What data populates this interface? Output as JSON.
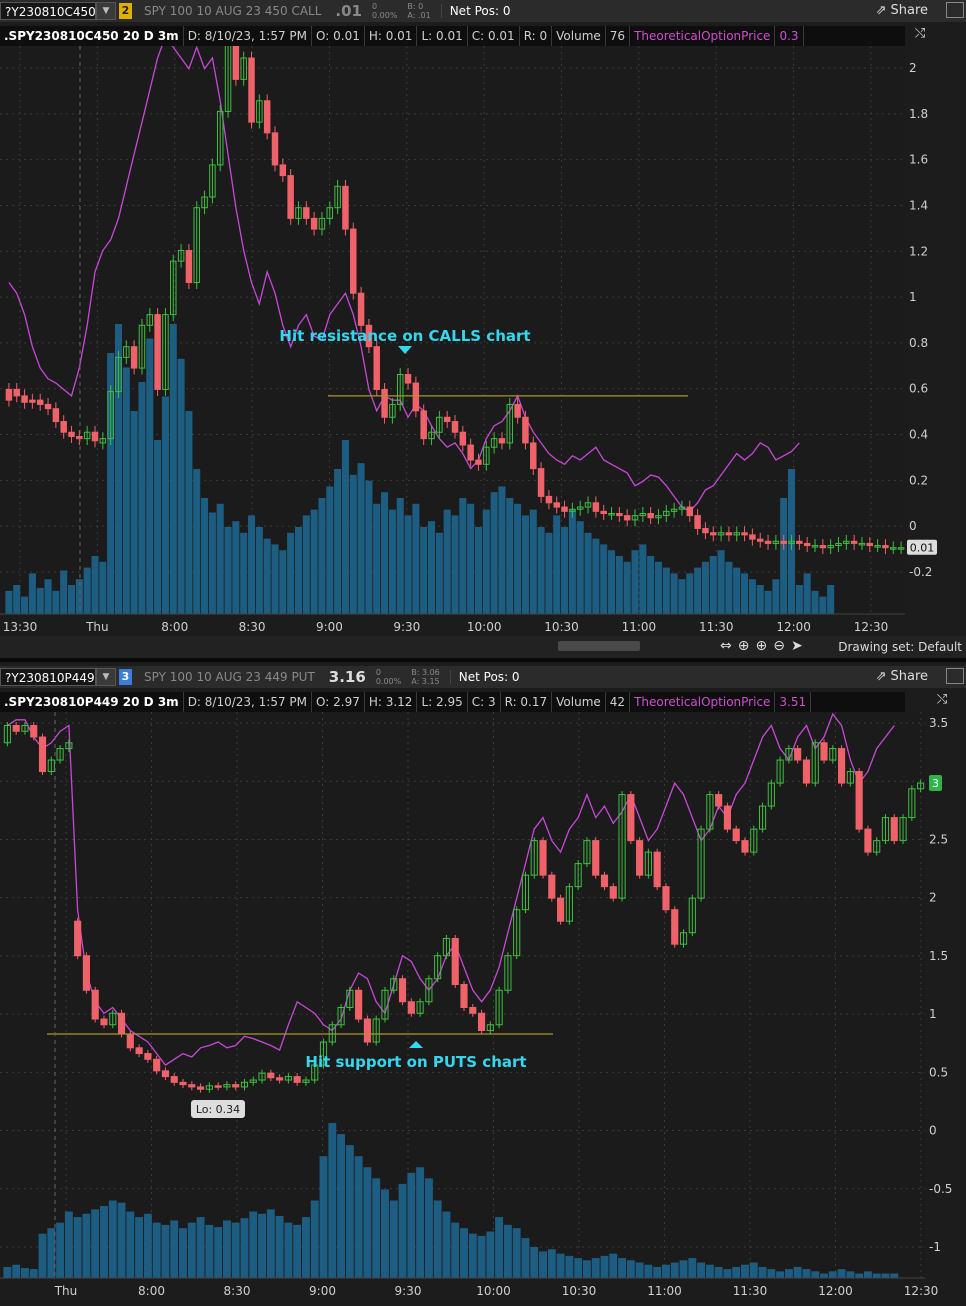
{
  "top": {
    "symbol": "?Y230810C450",
    "link_num": "2",
    "link_color": "#e0b000",
    "description": "SPY 100 10 AUG 23 450 CALL",
    "last": ".01",
    "change": "0",
    "change_pct": "0.00%",
    "bid": "B: 0",
    "ask": "A: .01",
    "net_pos": "Net Pos: 0",
    "share_label": "Share",
    "info": {
      "title": ".SPY230810C450 20 D 3m",
      "date": "D: 8/10/23, 1:57 PM",
      "open": "O: 0.01",
      "high": "H: 0.01",
      "low": "L: 0.01",
      "close": "C: 0.01",
      "range": "R: 0",
      "volume_label": "Volume",
      "volume_value": "76",
      "study_label": "TheoreticalOptionPrice",
      "study_value": "0.3"
    },
    "annotation": "Hit resistance on CALLS chart",
    "price_tag": "0.01",
    "drawing_set": "Drawing set: Default"
  },
  "bottom": {
    "symbol": "?Y230810P449",
    "link_num": "3",
    "link_color": "#3b7dd8",
    "description": "SPY 100 10 AUG 23 449 PUT",
    "last": "3.16",
    "change": "0",
    "change_pct": "0.00%",
    "bid": "B: 3.06",
    "ask": "A: 3.15",
    "net_pos": "Net Pos: 0",
    "share_label": "Share",
    "info": {
      "title": ".SPY230810P449 20 D 3m",
      "date": "D: 8/10/23, 1:57 PM",
      "open": "O: 2.97",
      "high": "H: 3.12",
      "low": "L: 2.95",
      "close": "C: 3",
      "range": "R: 0.17",
      "volume_label": "Volume",
      "volume_value": "42",
      "study_label": "TheoreticalOptionPrice",
      "study_value": "3.51"
    },
    "annotation": "Hit support on PUTS chart",
    "low_label": "Lo: 0.34",
    "price_tag": "3"
  },
  "colors": {
    "up": "#3fbf3f",
    "down": "#f0626a",
    "volume": "#1e5d82",
    "study": "#c848d8",
    "level": "#a8962a",
    "annotation": "#36d6ee",
    "grid": "#3a3a3a",
    "axis_text": "#cfcfcf"
  },
  "chart_data": [
    {
      "type": "candlestick",
      "title": ".SPY230810C450 20 D 3m",
      "x_ticks": [
        "13:30",
        "Thu",
        "8:00",
        "8:30",
        "9:00",
        "9:30",
        "10:00",
        "10:30",
        "11:00",
        "11:30",
        "12:00",
        "12:30"
      ],
      "y_ticks": [
        "-0.2",
        "0",
        "0.2",
        "0.4",
        "0.6",
        "0.8",
        "1",
        "1.2",
        "1.4",
        "1.6",
        "1.8",
        "2"
      ],
      "ylim": [
        -0.3,
        2.3
      ],
      "candles": [
        [
          0.75,
          0.7
        ],
        [
          0.75,
          0.72
        ],
        [
          0.72,
          0.69
        ],
        [
          0.7,
          0.69
        ],
        [
          0.7,
          0.68
        ],
        [
          0.68,
          0.66
        ],
        [
          0.66,
          0.6
        ],
        [
          0.6,
          0.55
        ],
        [
          0.55,
          0.53
        ],
        [
          0.53,
          0.52
        ],
        [
          0.52,
          0.55
        ],
        [
          0.55,
          0.51
        ],
        [
          0.5,
          0.52
        ],
        [
          0.52,
          0.74
        ],
        [
          0.74,
          0.9
        ],
        [
          0.9,
          0.95
        ],
        [
          0.95,
          0.85
        ],
        [
          0.85,
          1.05
        ],
        [
          1.05,
          1.1
        ],
        [
          1.1,
          0.75
        ],
        [
          0.75,
          1.1
        ],
        [
          1.1,
          1.35
        ],
        [
          1.35,
          1.4
        ],
        [
          1.4,
          1.25
        ],
        [
          1.25,
          1.6
        ],
        [
          1.6,
          1.65
        ],
        [
          1.65,
          1.8
        ],
        [
          1.8,
          2.05
        ],
        [
          2.05,
          2.4
        ],
        [
          2.4,
          2.2
        ],
        [
          2.2,
          2.3
        ],
        [
          2.3,
          2.0
        ],
        [
          2.0,
          2.1
        ],
        [
          2.1,
          1.95
        ],
        [
          1.95,
          1.8
        ],
        [
          1.8,
          1.75
        ],
        [
          1.75,
          1.55
        ],
        [
          1.55,
          1.6
        ],
        [
          1.6,
          1.55
        ],
        [
          1.55,
          1.5
        ],
        [
          1.5,
          1.55
        ],
        [
          1.55,
          1.6
        ],
        [
          1.6,
          1.7
        ],
        [
          1.7,
          1.5
        ],
        [
          1.5,
          1.2
        ],
        [
          1.2,
          1.05
        ],
        [
          1.05,
          0.95
        ],
        [
          0.95,
          0.75
        ],
        [
          0.75,
          0.62
        ],
        [
          0.62,
          0.68
        ],
        [
          0.68,
          0.82
        ],
        [
          0.82,
          0.78
        ],
        [
          0.78,
          0.65
        ],
        [
          0.65,
          0.52
        ],
        [
          0.52,
          0.55
        ],
        [
          0.55,
          0.62
        ],
        [
          0.62,
          0.6
        ],
        [
          0.6,
          0.55
        ],
        [
          0.55,
          0.49
        ],
        [
          0.49,
          0.42
        ],
        [
          0.42,
          0.4
        ],
        [
          0.4,
          0.48
        ],
        [
          0.48,
          0.52
        ],
        [
          0.52,
          0.5
        ],
        [
          0.5,
          0.68
        ],
        [
          0.68,
          0.62
        ],
        [
          0.62,
          0.5
        ],
        [
          0.5,
          0.38
        ],
        [
          0.38,
          0.25
        ],
        [
          0.25,
          0.22
        ],
        [
          0.22,
          0.2
        ],
        [
          0.2,
          0.18
        ],
        [
          0.18,
          0.19
        ],
        [
          0.19,
          0.2
        ],
        [
          0.2,
          0.22
        ],
        [
          0.22,
          0.18
        ],
        [
          0.18,
          0.17
        ],
        [
          0.17,
          0.17
        ],
        [
          0.17,
          0.16
        ],
        [
          0.16,
          0.14
        ],
        [
          0.14,
          0.16
        ],
        [
          0.16,
          0.17
        ],
        [
          0.17,
          0.15
        ],
        [
          0.15,
          0.16
        ],
        [
          0.16,
          0.18
        ],
        [
          0.18,
          0.19
        ],
        [
          0.19,
          0.2
        ],
        [
          0.2,
          0.16
        ],
        [
          0.16,
          0.1
        ],
        [
          0.1,
          0.08
        ],
        [
          0.08,
          0.07
        ],
        [
          0.07,
          0.08
        ],
        [
          0.08,
          0.07
        ],
        [
          0.07,
          0.08
        ],
        [
          0.08,
          0.07
        ],
        [
          0.07,
          0.05
        ],
        [
          0.05,
          0.04
        ],
        [
          0.04,
          0.03
        ],
        [
          0.03,
          0.04
        ],
        [
          0.04,
          0.03
        ],
        [
          0.03,
          0.04
        ],
        [
          0.04,
          0.03
        ],
        [
          0.03,
          0.02
        ],
        [
          0.02,
          0.02
        ],
        [
          0.02,
          0.01
        ],
        [
          0.01,
          0.02
        ],
        [
          0.02,
          0.03
        ],
        [
          0.03,
          0.04
        ],
        [
          0.04,
          0.03
        ],
        [
          0.03,
          0.03
        ],
        [
          0.03,
          0.02
        ],
        [
          0.02,
          0.02
        ],
        [
          0.02,
          0.01
        ],
        [
          0.01,
          0.01
        ],
        [
          0.01,
          0.01
        ]
      ],
      "study": [
        1.25,
        1.2,
        1.1,
        0.95,
        0.85,
        0.8,
        0.78,
        0.75,
        0.72,
        0.85,
        1.05,
        1.3,
        1.4,
        1.45,
        1.55,
        1.7,
        1.85,
        2.0,
        2.15,
        2.3,
        2.4,
        2.35,
        2.3,
        2.25,
        2.35,
        2.25,
        2.3,
        2.1,
        1.85,
        1.6,
        1.4,
        1.25,
        1.15,
        1.3,
        1.2,
        1.05,
        0.95,
        1.05,
        1.1,
        1.0,
        0.98,
        1.1,
        1.15,
        1.2,
        1.1,
        0.95,
        0.75,
        0.65,
        0.72,
        0.7,
        0.7,
        0.62,
        0.68,
        0.65,
        0.58,
        0.52,
        0.48,
        0.5,
        0.45,
        0.38,
        0.42,
        0.52,
        0.58,
        0.6,
        0.65,
        0.72,
        0.62,
        0.55,
        0.5,
        0.45,
        0.42,
        0.4,
        0.44,
        0.42,
        0.45,
        0.48,
        0.42,
        0.4,
        0.38,
        0.36,
        0.3,
        0.32,
        0.35,
        0.34,
        0.3,
        0.25,
        0.2,
        0.18,
        0.22,
        0.28,
        0.3,
        0.35,
        0.4,
        0.45,
        0.42,
        0.45,
        0.5,
        0.48,
        0.42,
        0.44,
        0.46,
        0.5
      ],
      "volume": [
        8,
        10,
        6,
        14,
        9,
        12,
        8,
        15,
        10,
        12,
        16,
        20,
        18,
        90,
        100,
        85,
        70,
        80,
        95,
        60,
        75,
        100,
        88,
        70,
        50,
        40,
        35,
        38,
        30,
        32,
        28,
        34,
        30,
        26,
        24,
        22,
        28,
        30,
        34,
        36,
        40,
        44,
        50,
        60,
        48,
        52,
        46,
        38,
        42,
        36,
        40,
        34,
        38,
        30,
        32,
        28,
        36,
        34,
        40,
        38,
        30,
        36,
        42,
        44,
        40,
        38,
        34,
        36,
        30,
        28,
        34,
        30,
        36,
        32,
        28,
        26,
        24,
        22,
        20,
        18,
        22,
        24,
        20,
        18,
        16,
        14,
        12,
        14,
        16,
        18,
        20,
        22,
        18,
        16,
        14,
        12,
        10,
        8,
        12,
        40,
        50,
        10,
        14,
        8,
        6,
        10
      ],
      "resistance_level": 0.72,
      "last_price": 0.01
    },
    {
      "type": "candlestick",
      "title": ".SPY230810P449 20 D 3m",
      "x_ticks": [
        "Thu",
        "8:00",
        "8:30",
        "9:00",
        "9:30",
        "10:00",
        "10:30",
        "11:00",
        "11:30",
        "12:00",
        "12:30"
      ],
      "y_ticks": [
        "-1",
        "-0.5",
        "0",
        "0.5",
        "1",
        "1.5",
        "2",
        "2.5",
        "3",
        "3.5"
      ],
      "ylim": [
        -1.3,
        3.6
      ],
      "candles": [
        [
          3.35,
          3.5
        ],
        [
          3.5,
          3.45
        ],
        [
          3.45,
          3.5
        ],
        [
          3.5,
          3.4
        ],
        [
          3.4,
          3.1
        ],
        [
          3.1,
          3.2
        ],
        [
          3.2,
          3.3
        ],
        [
          3.3,
          3.35
        ],
        [
          1.8,
          1.5
        ],
        [
          1.5,
          1.2
        ],
        [
          1.2,
          0.95
        ],
        [
          0.95,
          0.9
        ],
        [
          0.9,
          1.0
        ],
        [
          1.0,
          0.82
        ],
        [
          0.82,
          0.7
        ],
        [
          0.7,
          0.65
        ],
        [
          0.65,
          0.6
        ],
        [
          0.6,
          0.5
        ],
        [
          0.5,
          0.45
        ],
        [
          0.45,
          0.4
        ],
        [
          0.4,
          0.38
        ],
        [
          0.38,
          0.36
        ],
        [
          0.36,
          0.34
        ],
        [
          0.34,
          0.37
        ],
        [
          0.37,
          0.36
        ],
        [
          0.36,
          0.38
        ],
        [
          0.38,
          0.36
        ],
        [
          0.36,
          0.4
        ],
        [
          0.4,
          0.42
        ],
        [
          0.42,
          0.48
        ],
        [
          0.48,
          0.44
        ],
        [
          0.44,
          0.42
        ],
        [
          0.42,
          0.45
        ],
        [
          0.45,
          0.4
        ],
        [
          0.4,
          0.42
        ],
        [
          0.42,
          0.55
        ],
        [
          0.55,
          0.75
        ],
        [
          0.75,
          0.9
        ],
        [
          0.9,
          1.05
        ],
        [
          1.05,
          1.2
        ],
        [
          1.2,
          0.95
        ],
        [
          0.95,
          0.75
        ],
        [
          0.75,
          0.95
        ],
        [
          0.95,
          1.2
        ],
        [
          1.2,
          1.3
        ],
        [
          1.3,
          1.1
        ],
        [
          1.1,
          1.0
        ],
        [
          1.0,
          1.1
        ],
        [
          1.1,
          1.3
        ],
        [
          1.3,
          1.5
        ],
        [
          1.5,
          1.65
        ],
        [
          1.65,
          1.25
        ],
        [
          1.25,
          1.05
        ],
        [
          1.05,
          1.0
        ],
        [
          1.0,
          0.85
        ],
        [
          0.85,
          0.9
        ],
        [
          0.9,
          1.2
        ],
        [
          1.2,
          1.5
        ],
        [
          1.5,
          1.9
        ],
        [
          1.9,
          2.2
        ],
        [
          2.2,
          2.5
        ],
        [
          2.5,
          2.2
        ],
        [
          2.2,
          2.0
        ],
        [
          2.0,
          1.8
        ],
        [
          1.8,
          2.1
        ],
        [
          2.1,
          2.3
        ],
        [
          2.3,
          2.5
        ],
        [
          2.5,
          2.2
        ],
        [
          2.2,
          2.1
        ],
        [
          2.1,
          2.0
        ],
        [
          2.0,
          2.9
        ],
        [
          2.9,
          2.5
        ],
        [
          2.5,
          2.2
        ],
        [
          2.2,
          2.4
        ],
        [
          2.4,
          2.1
        ],
        [
          2.1,
          1.9
        ],
        [
          1.9,
          1.6
        ],
        [
          1.6,
          1.7
        ],
        [
          1.7,
          2.0
        ],
        [
          2.0,
          2.6
        ],
        [
          2.6,
          2.9
        ],
        [
          2.9,
          2.8
        ],
        [
          2.8,
          2.6
        ],
        [
          2.6,
          2.5
        ],
        [
          2.5,
          2.4
        ],
        [
          2.4,
          2.6
        ],
        [
          2.6,
          2.8
        ],
        [
          2.8,
          3.0
        ],
        [
          3.0,
          3.2
        ],
        [
          3.2,
          3.3
        ],
        [
          3.3,
          3.2
        ],
        [
          3.2,
          3.0
        ],
        [
          3.0,
          3.35
        ],
        [
          3.35,
          3.2
        ],
        [
          3.2,
          3.3
        ],
        [
          3.3,
          3.0
        ],
        [
          3.0,
          3.1
        ],
        [
          3.1,
          2.6
        ],
        [
          2.6,
          2.4
        ],
        [
          2.4,
          2.5
        ],
        [
          2.5,
          2.7
        ],
        [
          2.7,
          2.5
        ],
        [
          2.5,
          2.7
        ],
        [
          2.7,
          2.95
        ],
        [
          2.95,
          3.0
        ]
      ],
      "study": [
        3.5,
        3.55,
        3.55,
        3.4,
        3.3,
        3.35,
        3.45,
        3.5,
        1.9,
        1.35,
        1.1,
        1.0,
        1.05,
        0.95,
        0.85,
        0.8,
        0.75,
        0.65,
        0.55,
        0.6,
        0.65,
        0.62,
        0.7,
        0.72,
        0.75,
        0.7,
        0.72,
        0.8,
        0.78,
        0.75,
        0.72,
        0.68,
        0.9,
        1.1,
        1.05,
        1.0,
        0.9,
        0.85,
        0.95,
        1.2,
        1.35,
        1.3,
        1.1,
        1.0,
        1.25,
        1.5,
        1.45,
        1.3,
        1.2,
        1.3,
        1.5,
        1.6,
        1.4,
        1.2,
        1.1,
        1.2,
        1.4,
        1.7,
        2.0,
        2.3,
        2.6,
        2.7,
        2.5,
        2.4,
        2.6,
        2.7,
        2.9,
        2.7,
        2.8,
        2.65,
        2.75,
        2.9,
        2.7,
        2.5,
        2.6,
        2.8,
        3.0,
        2.9,
        2.7,
        2.5,
        2.6,
        2.8,
        2.7,
        2.9,
        3.0,
        3.2,
        3.4,
        3.5,
        3.3,
        3.2,
        3.4,
        3.5,
        3.3,
        3.4,
        3.6,
        3.5,
        3.2,
        3.0,
        3.1,
        3.3,
        3.4,
        3.5
      ],
      "volume": [
        10,
        12,
        9,
        8,
        40,
        45,
        50,
        60,
        55,
        58,
        62,
        65,
        70,
        68,
        60,
        55,
        58,
        50,
        48,
        52,
        45,
        50,
        55,
        48,
        46,
        52,
        50,
        54,
        60,
        58,
        62,
        56,
        50,
        48,
        55,
        70,
        110,
        140,
        130,
        120,
        110,
        100,
        90,
        80,
        70,
        85,
        95,
        100,
        90,
        70,
        60,
        50,
        45,
        40,
        38,
        42,
        55,
        48,
        45,
        36,
        28,
        24,
        26,
        22,
        20,
        18,
        16,
        18,
        20,
        22,
        18,
        16,
        14,
        12,
        10,
        12,
        14,
        16,
        18,
        14,
        12,
        10,
        8,
        10,
        12,
        14,
        10,
        8,
        6,
        8,
        10,
        8,
        6,
        4,
        6,
        8,
        6,
        4,
        6,
        4,
        4,
        4
      ],
      "support_level": 0.82,
      "low": 0.34,
      "last_price": 3
    }
  ]
}
